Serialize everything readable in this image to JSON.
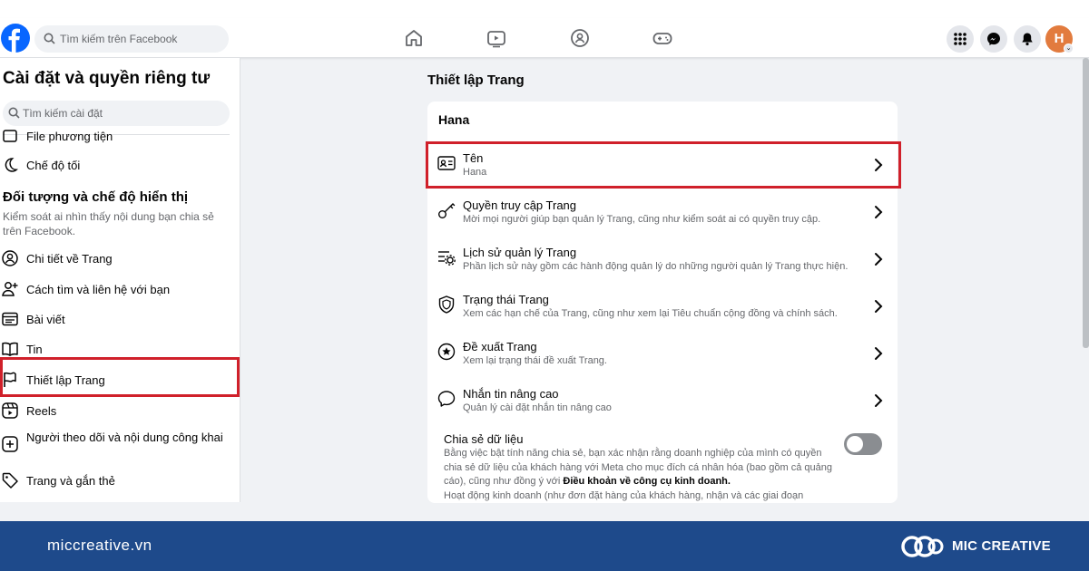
{
  "topbar": {
    "search_placeholder": "Tìm kiếm trên Facebook",
    "nav": [
      "home-icon",
      "watch-icon",
      "groups-icon",
      "gaming-icon"
    ],
    "avatar_letter": "H"
  },
  "sidebar": {
    "title": "Cài đặt và quyền riêng tư",
    "search_placeholder": "Tìm kiếm cài đặt",
    "items_top": [
      {
        "label": "File phương tiện",
        "icon": "media-icon"
      },
      {
        "label": "Chế độ tối",
        "icon": "moon-icon"
      }
    ],
    "section_title": "Đối tượng và chế độ hiển thị",
    "section_desc": "Kiểm soát ai nhìn thấy nội dung bạn chia sẻ trên Facebook.",
    "items": [
      {
        "label": "Chi tiết về Trang",
        "icon": "user-circle-icon"
      },
      {
        "label": "Cách tìm và liên hệ với bạn",
        "icon": "user-plus-icon"
      },
      {
        "label": "Bài viết",
        "icon": "posts-icon"
      },
      {
        "label": "Tin",
        "icon": "book-icon"
      },
      {
        "label": "Thiết lập Trang",
        "icon": "flag-icon"
      },
      {
        "label": "Reels",
        "icon": "reels-icon"
      },
      {
        "label": "Người theo dõi và nội dung công khai",
        "icon": "add-square-icon"
      },
      {
        "label": "Trang và gắn thẻ",
        "icon": "tag-icon"
      }
    ]
  },
  "main": {
    "title": "Thiết lập Trang",
    "card_title": "Hana",
    "rows": [
      {
        "title": "Tên",
        "subtitle": "Hana",
        "icon": "id-card-icon"
      },
      {
        "title": "Quyền truy cập Trang",
        "subtitle": "Mời mọi người giúp bạn quản lý Trang, cũng như kiểm soát ai có quyền truy cập.",
        "icon": "key-icon"
      },
      {
        "title": "Lịch sử quản lý Trang",
        "subtitle": "Phần lịch sử này gồm các hành động quản lý do những người quản lý Trang thực hiện.",
        "icon": "history-gear-icon"
      },
      {
        "title": "Trạng thái Trang",
        "subtitle": "Xem các hạn chế của Trang, cũng như xem lại Tiêu chuẩn cộng đồng và chính sách.",
        "icon": "shield-icon"
      },
      {
        "title": "Đề xuất Trang",
        "subtitle": "Xem lại trạng thái đề xuất Trang.",
        "icon": "star-badge-icon"
      },
      {
        "title": "Nhắn tin nâng cao",
        "subtitle": "Quản lý cài đặt nhắn tin nâng cao",
        "icon": "chat-icon"
      }
    ],
    "share": {
      "title": "Chia sẻ dữ liệu",
      "desc_part1": "Bằng việc bật tính năng chia sẻ, bạn xác nhận rằng doanh nghiệp của mình có quyền chia sẻ dữ liệu của khách hàng với Meta cho mục đích cá nhân hóa (bao gồm cả quảng cáo), cũng như đồng ý với ",
      "desc_link": "Điều khoản về công cụ kinh doanh.",
      "desc_part2": "Hoạt động kinh doanh (như đơn đặt hàng của khách hàng, nhận và các giai đoạn",
      "toggle_on": false
    }
  },
  "footer": {
    "url": "miccreative.vn",
    "brand": "MIC CREATIVE"
  },
  "colors": {
    "facebook_blue": "#0866ff",
    "highlight_red": "#d0202a",
    "footer_blue": "#1e4a8b"
  }
}
